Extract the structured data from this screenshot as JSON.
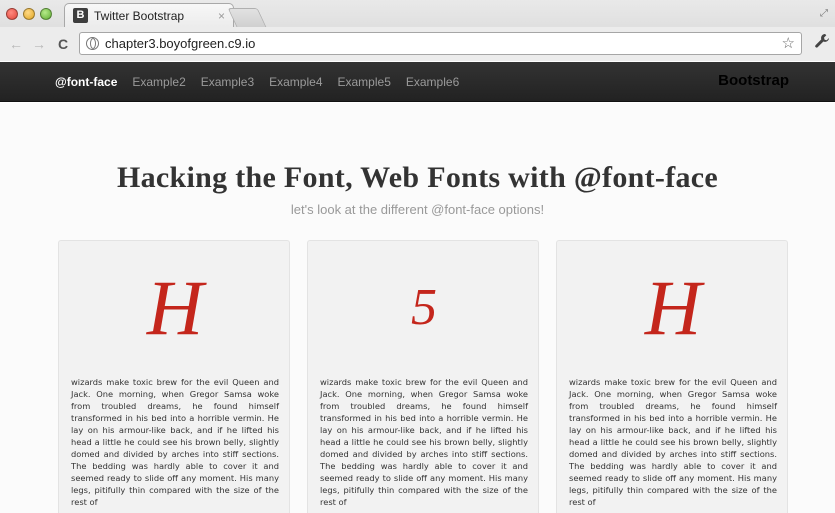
{
  "browser": {
    "tab_title": "Twitter Bootstrap",
    "tab_favicon_letter": "B",
    "tab_close": "×",
    "url": "chapter3.boyofgreen.c9.io",
    "back_icon": "←",
    "forward_icon": "→",
    "reload_icon": "C",
    "star_icon": "☆",
    "wrench_icon": "🔧"
  },
  "navbar": {
    "links": [
      "@font-face",
      "Example2",
      "Example3",
      "Example4",
      "Example5",
      "Example6"
    ],
    "brand": "Bootstrap"
  },
  "hero": {
    "title": "Hacking the Font, Web Fonts with @font-face",
    "subtitle": "let's look at the different @font-face options!"
  },
  "cards": [
    {
      "glyph": "H",
      "text": "wizards make toxic brew for the evil Queen and Jack. One morning, when Gregor Samsa woke from troubled dreams, he found himself transformed in his bed into a horrible vermin. He lay on his armour-like back, and if he lifted his head a little he could see his brown belly, slightly domed and divided by arches into stiff sections. The bedding was hardly able to cover it and seemed ready to slide off any moment. His many legs, pitifully thin compared with the size of the rest of"
    },
    {
      "glyph": "5",
      "text": "wizards make toxic brew for the evil Queen and Jack. One morning, when Gregor Samsa woke from troubled dreams, he found himself transformed in his bed into a horrible vermin. He lay on his armour-like back, and if he lifted his head a little he could see his brown belly, slightly domed and divided by arches into stiff sections. The bedding was hardly able to cover it and seemed ready to slide off any moment. His many legs, pitifully thin compared with the size of the rest of"
    },
    {
      "glyph": "H",
      "text": "wizards make toxic brew for the evil Queen and Jack. One morning, when Gregor Samsa woke from troubled dreams, he found himself transformed in his bed into a horrible vermin. He lay on his armour-like back, and if he lifted his head a little he could see his brown belly, slightly domed and divided by arches into stiff sections. The bedding was hardly able to cover it and seemed ready to slide off any moment. His many legs, pitifully thin compared with the size of the rest of"
    }
  ],
  "colors": {
    "glyph_red": "#c4261c",
    "navbar_bg": "#222222",
    "nav_active": "#ffffff",
    "nav_inactive": "#9a9a9a"
  }
}
